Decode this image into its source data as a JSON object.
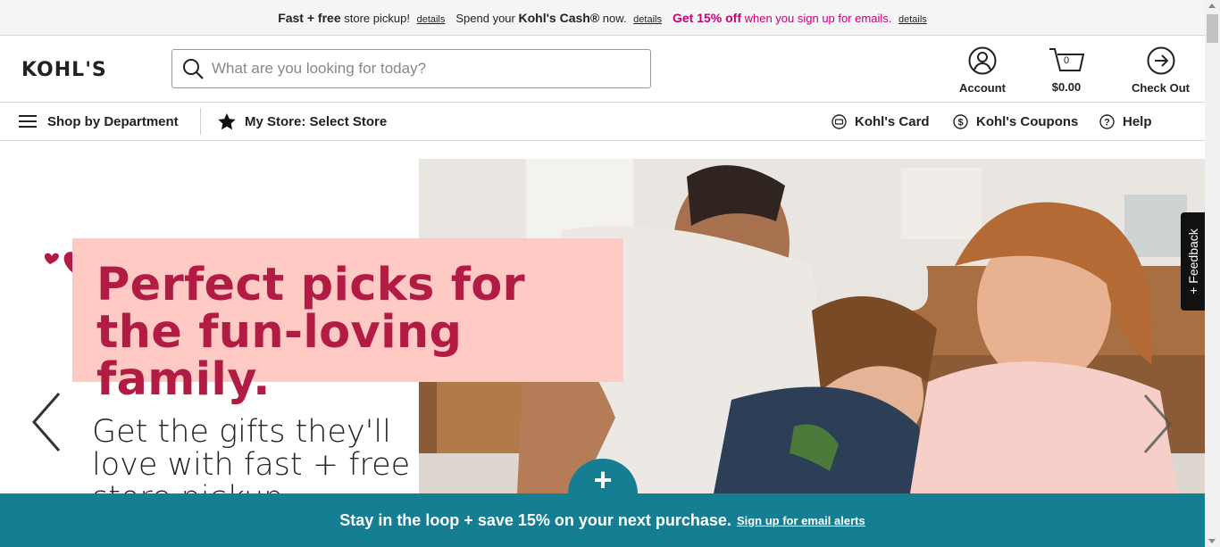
{
  "topbar": {
    "pickup_bold": "Fast + free",
    "pickup_text": "store pickup!",
    "pickup_link": "details",
    "cash_pre": "Spend your",
    "cash_bold": "Kohl's Cash®",
    "cash_post": "now.",
    "cash_link": "details",
    "email_bold": "Get 15% off",
    "email_text": "when you sign up for emails.",
    "email_link": "details"
  },
  "header": {
    "logo": "KOHL'S",
    "search_placeholder": "What are you looking for today?",
    "account_label": "Account",
    "cart_count": "0",
    "cart_total": "$0.00",
    "checkout_label": "Check Out"
  },
  "subnav": {
    "department": "Shop by Department",
    "store": "My Store: Select Store",
    "card": "Kohl's Card",
    "coupons": "Kohl's Coupons",
    "help": "Help"
  },
  "hero": {
    "headline": "Perfect picks for the fun-loving family.",
    "subtext": "Get the gifts they'll love with fast + free store pickup."
  },
  "feedback": "Feedback",
  "email_banner": {
    "text": "Stay in the loop + save 15% on your next purchase.",
    "link": "Sign up for email alerts"
  },
  "colors": {
    "brand_pink": "#b11b44",
    "promo_bg": "#ffc9c4",
    "teal": "#157e93",
    "magenta": "#c4007a"
  }
}
